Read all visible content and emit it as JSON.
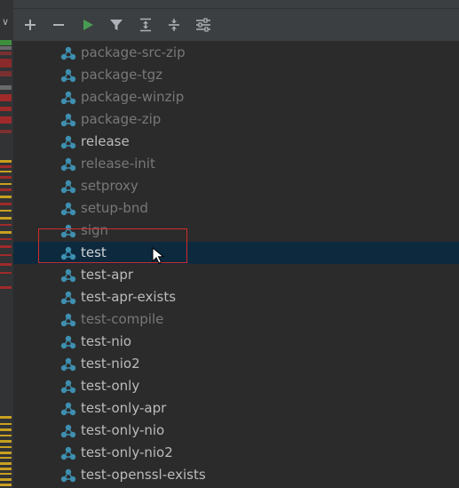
{
  "toolbar": {
    "buttons": [
      {
        "name": "add-icon",
        "glyph": "plus"
      },
      {
        "name": "remove-icon",
        "glyph": "minus"
      },
      {
        "name": "run-icon",
        "glyph": "play"
      },
      {
        "name": "filter-icon",
        "glyph": "funnel"
      },
      {
        "name": "expand-all-icon",
        "glyph": "expand"
      },
      {
        "name": "collapse-all-icon",
        "glyph": "collapse"
      },
      {
        "name": "settings-icon",
        "glyph": "sliders"
      }
    ]
  },
  "colors": {
    "run_green": "#499c54",
    "target_icon": "#3e8fb0",
    "selection": "#0d293e",
    "highlight_box": "#d12b2b"
  },
  "targets": [
    {
      "label": "package-src-zip",
      "state": "dim"
    },
    {
      "label": "package-tgz",
      "state": "dim"
    },
    {
      "label": "package-winzip",
      "state": "dim"
    },
    {
      "label": "package-zip",
      "state": "dim"
    },
    {
      "label": "release",
      "state": "bright"
    },
    {
      "label": "release-init",
      "state": "dim"
    },
    {
      "label": "setproxy",
      "state": "dim"
    },
    {
      "label": "setup-bnd",
      "state": "dim"
    },
    {
      "label": "sign",
      "state": "dim"
    },
    {
      "label": "test",
      "state": "white",
      "selected": true
    },
    {
      "label": "test-apr",
      "state": "bright"
    },
    {
      "label": "test-apr-exists",
      "state": "bright"
    },
    {
      "label": "test-compile",
      "state": "dim"
    },
    {
      "label": "test-nio",
      "state": "bright"
    },
    {
      "label": "test-nio2",
      "state": "bright"
    },
    {
      "label": "test-only",
      "state": "bright"
    },
    {
      "label": "test-only-apr",
      "state": "bright"
    },
    {
      "label": "test-only-nio",
      "state": "bright"
    },
    {
      "label": "test-only-nio2",
      "state": "bright"
    },
    {
      "label": "test-openssl-exists",
      "state": "bright"
    }
  ]
}
